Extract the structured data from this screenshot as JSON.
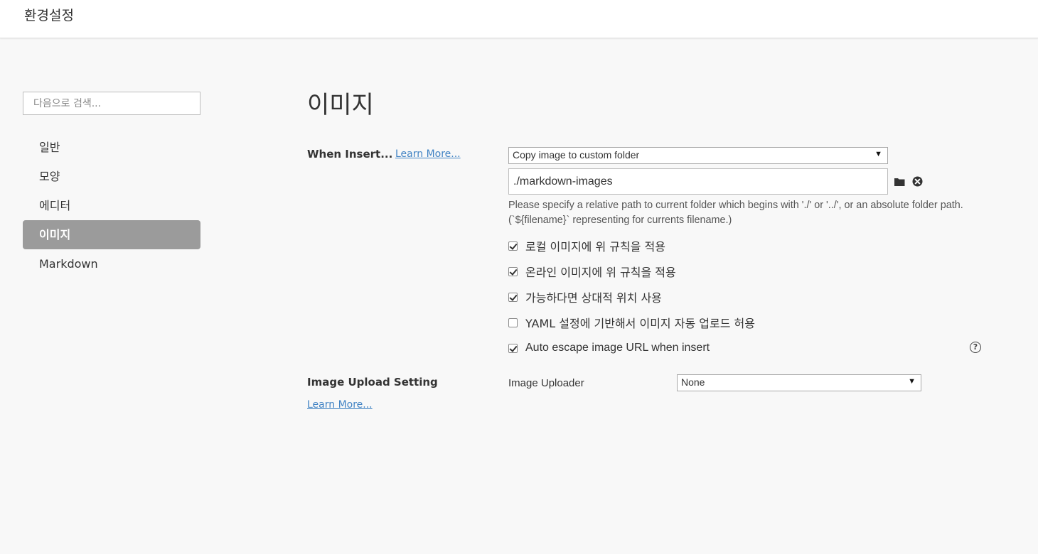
{
  "window": {
    "title": "환경설정"
  },
  "sidebar": {
    "search_placeholder": "다음으로 검색...",
    "items": [
      {
        "label": "일반",
        "active": false
      },
      {
        "label": "모양",
        "active": false
      },
      {
        "label": "에디터",
        "active": false
      },
      {
        "label": "이미지",
        "active": true
      },
      {
        "label": "Markdown",
        "active": false
      }
    ]
  },
  "main": {
    "page_title": "이미지",
    "when_insert": {
      "label": "When Insert...",
      "learn_more": "Learn More...",
      "action_select": "Copy image to custom folder",
      "folder_path": "./markdown-images",
      "hint": "Please specify a relative path to current folder which begins with './' or '../', or an absolute folder path. (`${filename}` representing for currents filename.)",
      "options": [
        {
          "label": "로컬 이미지에 위 규칙을 적용",
          "checked": true
        },
        {
          "label": "온라인 이미지에 위 규칙을 적용",
          "checked": true
        },
        {
          "label": "가능하다면 상대적 위치 사용",
          "checked": true
        },
        {
          "label": "YAML 설정에 기반해서 이미지 자동 업로드 허용",
          "checked": false
        },
        {
          "label": "Auto escape image URL when insert",
          "checked": true
        }
      ]
    },
    "upload": {
      "label": "Image Upload Setting",
      "learn_more": "Learn More...",
      "uploader_label": "Image Uploader",
      "uploader_value": "None"
    }
  },
  "icons": {
    "folder": "folder-icon",
    "clear": "close-circle-icon",
    "help": "question-circle-icon",
    "dropdown": "caret-down-icon"
  }
}
